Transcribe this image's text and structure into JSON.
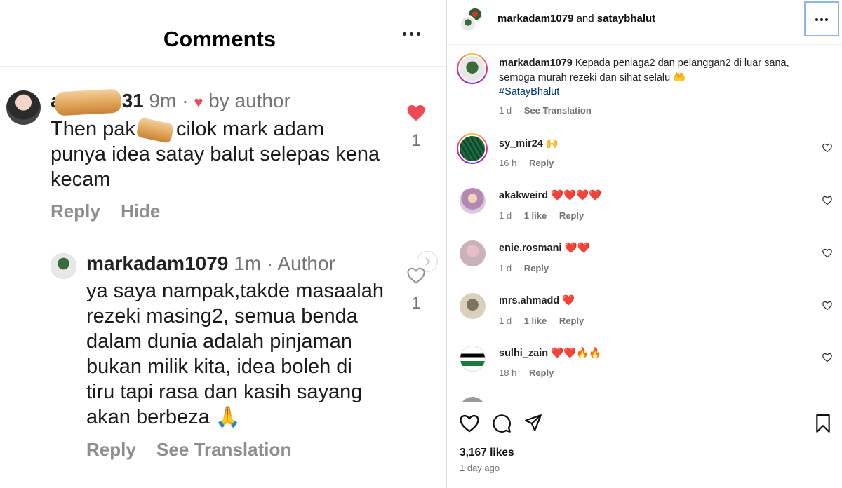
{
  "left_panel": {
    "title": "Comments",
    "comment": {
      "username_partial_start": "a",
      "username_partial_end": "31",
      "time": "9m",
      "separator": " · ",
      "liked_by_author": "by author",
      "body_start": "Then pak",
      "body_rest_line1": " cilok mark adam",
      "body_line2": "punya idea satay balut selepas kena",
      "body_line3": "kecam",
      "like_count": "1",
      "actions": [
        "Reply",
        "Hide"
      ]
    },
    "reply": {
      "username": "markadam1079",
      "time": "1m",
      "separator": " · ",
      "badge": "Author",
      "body_lines": [
        "ya saya nampak,takde masaalah",
        "rezeki masing2, semua benda",
        "dalam dunia adalah pinjaman",
        "bukan milik kita,  idea boleh di",
        "tiru tapi rasa dan kasih sayang",
        "akan berbeza 🙏"
      ],
      "like_count": "1",
      "actions": [
        "Reply",
        "See Translation"
      ]
    }
  },
  "right_panel": {
    "header": {
      "user1": "markadam1079",
      "and": "and",
      "user2": "sataybhalut"
    },
    "caption": {
      "username": "markadam1079",
      "text": "Kepada peniaga2 dan pelanggan2 di luar sana, semoga murah rezeki dan sihat selalu 🤲",
      "hashtag": "#SatayBhalut",
      "time": "1 d",
      "see_translation": "See Translation"
    },
    "comments": [
      {
        "username": "sy_mir24",
        "text": "🙌",
        "time": "16 h",
        "likes": "",
        "reply": "Reply"
      },
      {
        "username": "akakweird",
        "text": "❤️❤️❤️❤️",
        "time": "1 d",
        "likes": "1 like",
        "reply": "Reply"
      },
      {
        "username": "enie.rosmani",
        "text": "❤️❤️",
        "time": "1 d",
        "likes": "",
        "reply": "Reply"
      },
      {
        "username": "mrs.ahmadd",
        "text": "❤️",
        "time": "1 d",
        "likes": "1 like",
        "reply": "Reply"
      },
      {
        "username": "sulhi_zain",
        "text": "❤️❤️🔥🔥",
        "time": "18 h",
        "likes": "",
        "reply": "Reply"
      }
    ],
    "likes_count": "3,167 likes",
    "posted": "1 day ago"
  },
  "colors": {
    "heart_red": "#ed4956",
    "meta_gray": "#737373",
    "hashtag_blue": "#00376b",
    "selection_blue": "#8fb6e8"
  }
}
